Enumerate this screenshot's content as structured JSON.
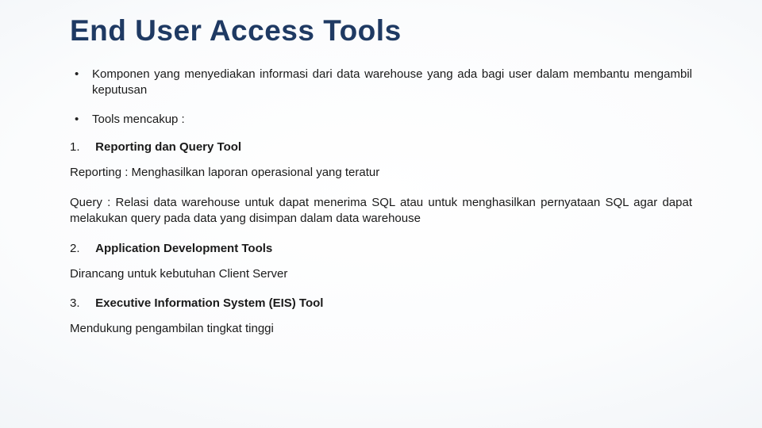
{
  "title": "End User Access Tools",
  "bullets": [
    "Komponen yang menyediakan informasi dari data warehouse   yang   ada bagi user dalam membantu mengambil keputusan",
    "Tools mencakup :"
  ],
  "items": [
    {
      "num": "1.",
      "label": "Reporting dan Query Tool"
    },
    {
      "num": "2.",
      "label": "Application Development Tools"
    },
    {
      "num": "3.",
      "label": "Executive Information System (EIS) Tool"
    }
  ],
  "paras": {
    "reporting": "Reporting : Menghasilkan laporan operasional yang teratur",
    "query": "Query : Relasi data warehouse untuk dapat menerima SQL atau untuk menghasilkan pernyataan SQL agar dapat melakukan query pada data  yang disimpan dalam data warehouse",
    "adt": "Dirancang untuk kebutuhan Client Server",
    "eis": "Mendukung pengambilan tingkat tinggi"
  }
}
